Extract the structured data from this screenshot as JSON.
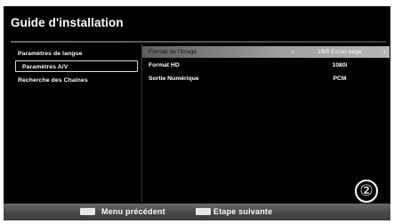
{
  "title": "Guide d'installation",
  "menu": {
    "items": [
      {
        "label": "Paramètres de langue"
      },
      {
        "label": "Paramètres A/V"
      },
      {
        "label": "Recherche des Chaînes"
      }
    ]
  },
  "settings": [
    {
      "label": "Format de l'image",
      "value": "16/9 Ecran large"
    },
    {
      "label": "Format HD",
      "value": "1080i"
    },
    {
      "label": "Sortie Numérique",
      "value": "PCM"
    }
  ],
  "step_number": "②",
  "footer": {
    "prev_label": "Menu précédent",
    "next_label": "Etape suivante"
  },
  "icons": {
    "left_arrow": "‹",
    "right_arrow": "›"
  }
}
